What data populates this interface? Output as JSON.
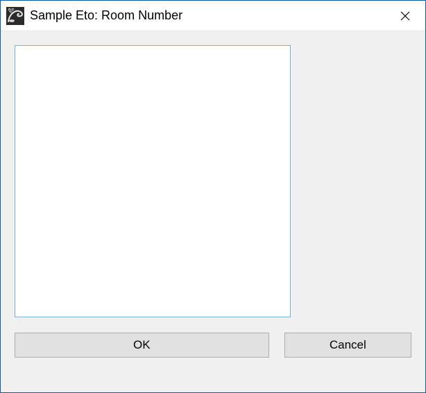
{
  "window": {
    "title": "Sample Eto: Room Number"
  },
  "input": {
    "value": ""
  },
  "buttons": {
    "ok": "OK",
    "cancel": "Cancel"
  }
}
